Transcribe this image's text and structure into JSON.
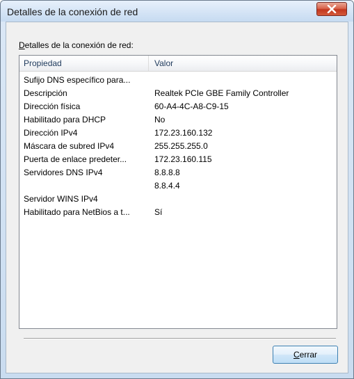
{
  "window": {
    "title": "Detalles de la conexión de red"
  },
  "group": {
    "label_first": "D",
    "label_rest": "etalles de la conexión de red:"
  },
  "list": {
    "columns": {
      "property": "Propiedad",
      "value": "Valor"
    },
    "rows": [
      {
        "property": "Sufijo DNS específico para...",
        "value": ""
      },
      {
        "property": "Descripción",
        "value": "Realtek PCIe GBE Family Controller"
      },
      {
        "property": "Dirección física",
        "value": "60-A4-4C-A8-C9-15"
      },
      {
        "property": "Habilitado para DHCP",
        "value": "No"
      },
      {
        "property": "Dirección IPv4",
        "value": "172.23.160.132"
      },
      {
        "property": "Máscara de subred IPv4",
        "value": "255.255.255.0"
      },
      {
        "property": "Puerta de enlace predeter...",
        "value": "172.23.160.115"
      },
      {
        "property": "Servidores DNS IPv4",
        "value": "8.8.8.8"
      },
      {
        "property": "",
        "value": "8.8.4.4"
      },
      {
        "property": "Servidor WINS IPv4",
        "value": ""
      },
      {
        "property": "Habilitado para NetBios a t...",
        "value": "Sí"
      }
    ]
  },
  "buttons": {
    "close_first": "C",
    "close_rest": "errar"
  },
  "icons": {
    "close": "close-icon"
  },
  "colors": {
    "close_button": "#c2371f",
    "title_bar": "#d3e3f5"
  }
}
